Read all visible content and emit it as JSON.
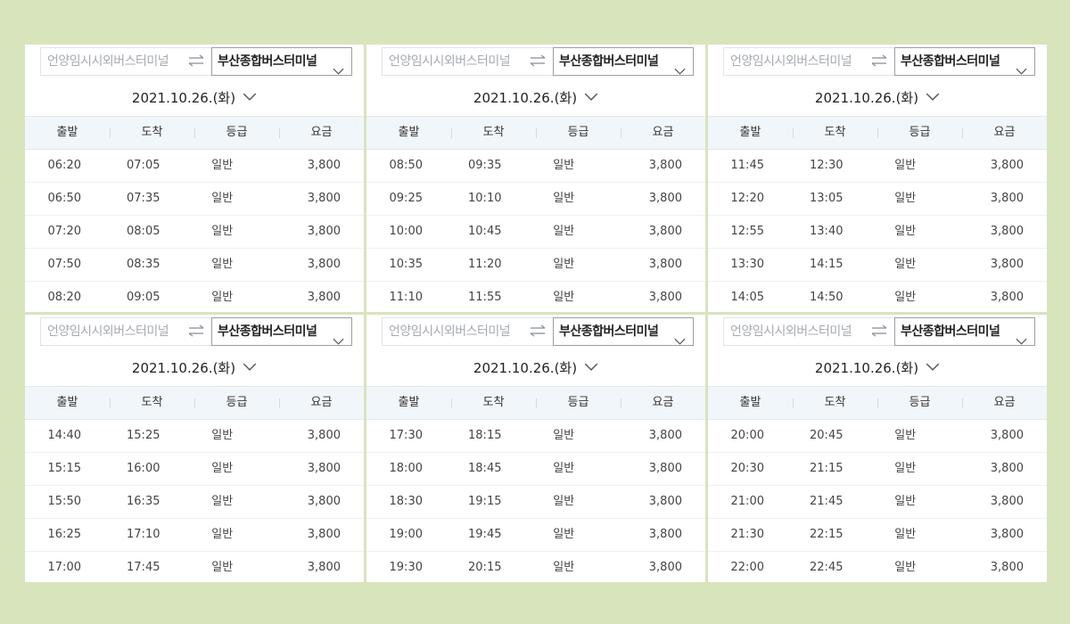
{
  "route": {
    "departure_placeholder": "언양임시시외버스터미널",
    "arrival": "부산종합버스터미널",
    "date": "2021.10.26.(화)"
  },
  "columns": [
    "출발",
    "도착",
    "등급",
    "요금"
  ],
  "icons": {
    "swap": "swap-arrows-icon",
    "dropdown": "chevron-down-icon"
  },
  "colors": {
    "background": "#d8e4bc",
    "header_row": "#f1f6fa"
  },
  "panels": [
    {
      "rows": [
        [
          "06:20",
          "07:05",
          "일반",
          "3,800"
        ],
        [
          "06:50",
          "07:35",
          "일반",
          "3,800"
        ],
        [
          "07:20",
          "08:05",
          "일반",
          "3,800"
        ],
        [
          "07:50",
          "08:35",
          "일반",
          "3,800"
        ],
        [
          "08:20",
          "09:05",
          "일반",
          "3,800"
        ]
      ]
    },
    {
      "rows": [
        [
          "08:50",
          "09:35",
          "일반",
          "3,800"
        ],
        [
          "09:25",
          "10:10",
          "일반",
          "3,800"
        ],
        [
          "10:00",
          "10:45",
          "일반",
          "3,800"
        ],
        [
          "10:35",
          "11:20",
          "일반",
          "3,800"
        ],
        [
          "11:10",
          "11:55",
          "일반",
          "3,800"
        ]
      ]
    },
    {
      "rows": [
        [
          "11:45",
          "12:30",
          "일반",
          "3,800"
        ],
        [
          "12:20",
          "13:05",
          "일반",
          "3,800"
        ],
        [
          "12:55",
          "13:40",
          "일반",
          "3,800"
        ],
        [
          "13:30",
          "14:15",
          "일반",
          "3,800"
        ],
        [
          "14:05",
          "14:50",
          "일반",
          "3,800"
        ]
      ]
    },
    {
      "rows": [
        [
          "14:40",
          "15:25",
          "일반",
          "3,800"
        ],
        [
          "15:15",
          "16:00",
          "일반",
          "3,800"
        ],
        [
          "15:50",
          "16:35",
          "일반",
          "3,800"
        ],
        [
          "16:25",
          "17:10",
          "일반",
          "3,800"
        ],
        [
          "17:00",
          "17:45",
          "일반",
          "3,800"
        ]
      ]
    },
    {
      "rows": [
        [
          "17:30",
          "18:15",
          "일반",
          "3,800"
        ],
        [
          "18:00",
          "18:45",
          "일반",
          "3,800"
        ],
        [
          "18:30",
          "19:15",
          "일반",
          "3,800"
        ],
        [
          "19:00",
          "19:45",
          "일반",
          "3,800"
        ],
        [
          "19:30",
          "20:15",
          "일반",
          "3,800"
        ]
      ]
    },
    {
      "rows": [
        [
          "20:00",
          "20:45",
          "일반",
          "3,800"
        ],
        [
          "20:30",
          "21:15",
          "일반",
          "3,800"
        ],
        [
          "21:00",
          "21:45",
          "일반",
          "3,800"
        ],
        [
          "21:30",
          "22:15",
          "일반",
          "3,800"
        ],
        [
          "22:00",
          "22:45",
          "일반",
          "3,800"
        ]
      ]
    }
  ]
}
